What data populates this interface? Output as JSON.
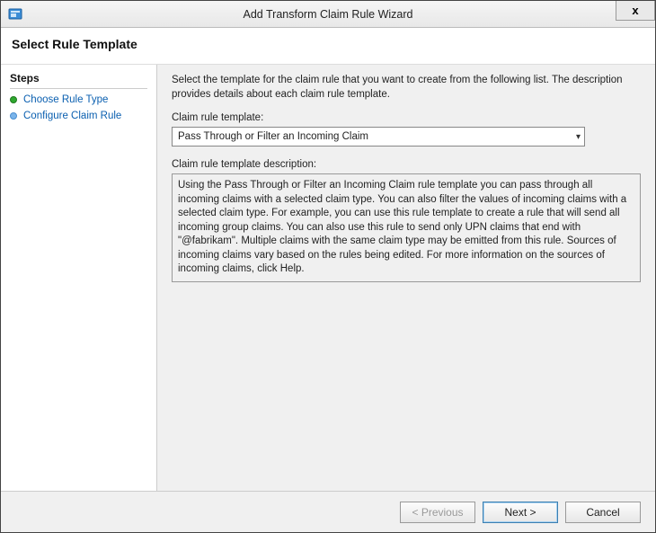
{
  "titlebar": {
    "title": "Add Transform Claim Rule Wizard",
    "close_glyph": "x"
  },
  "header": {
    "title": "Select Rule Template"
  },
  "sidebar": {
    "title": "Steps",
    "items": [
      {
        "label": "Choose Rule Type",
        "active": true
      },
      {
        "label": "Configure Claim Rule",
        "active": false
      }
    ]
  },
  "main": {
    "instruction": "Select the template for the claim rule that you want to create from the following list. The description provides details about each claim rule template.",
    "template_label": "Claim rule template:",
    "template_selected": "Pass Through or Filter an Incoming Claim",
    "description_label": "Claim rule template description:",
    "description_text": "Using the Pass Through or Filter an Incoming Claim rule template you can pass through all incoming claims with a selected claim type.  You can also filter the values of incoming claims with a selected claim type.  For example, you can use this rule template to create a rule that will send all incoming group claims.  You can also use this rule to send only UPN claims that end with \"@fabrikam\".  Multiple claims with the same claim type may be emitted from this rule.  Sources of incoming claims vary based on the rules being edited.  For more information on the sources of incoming claims, click Help."
  },
  "footer": {
    "previous": "< Previous",
    "next": "Next >",
    "cancel": "Cancel"
  }
}
